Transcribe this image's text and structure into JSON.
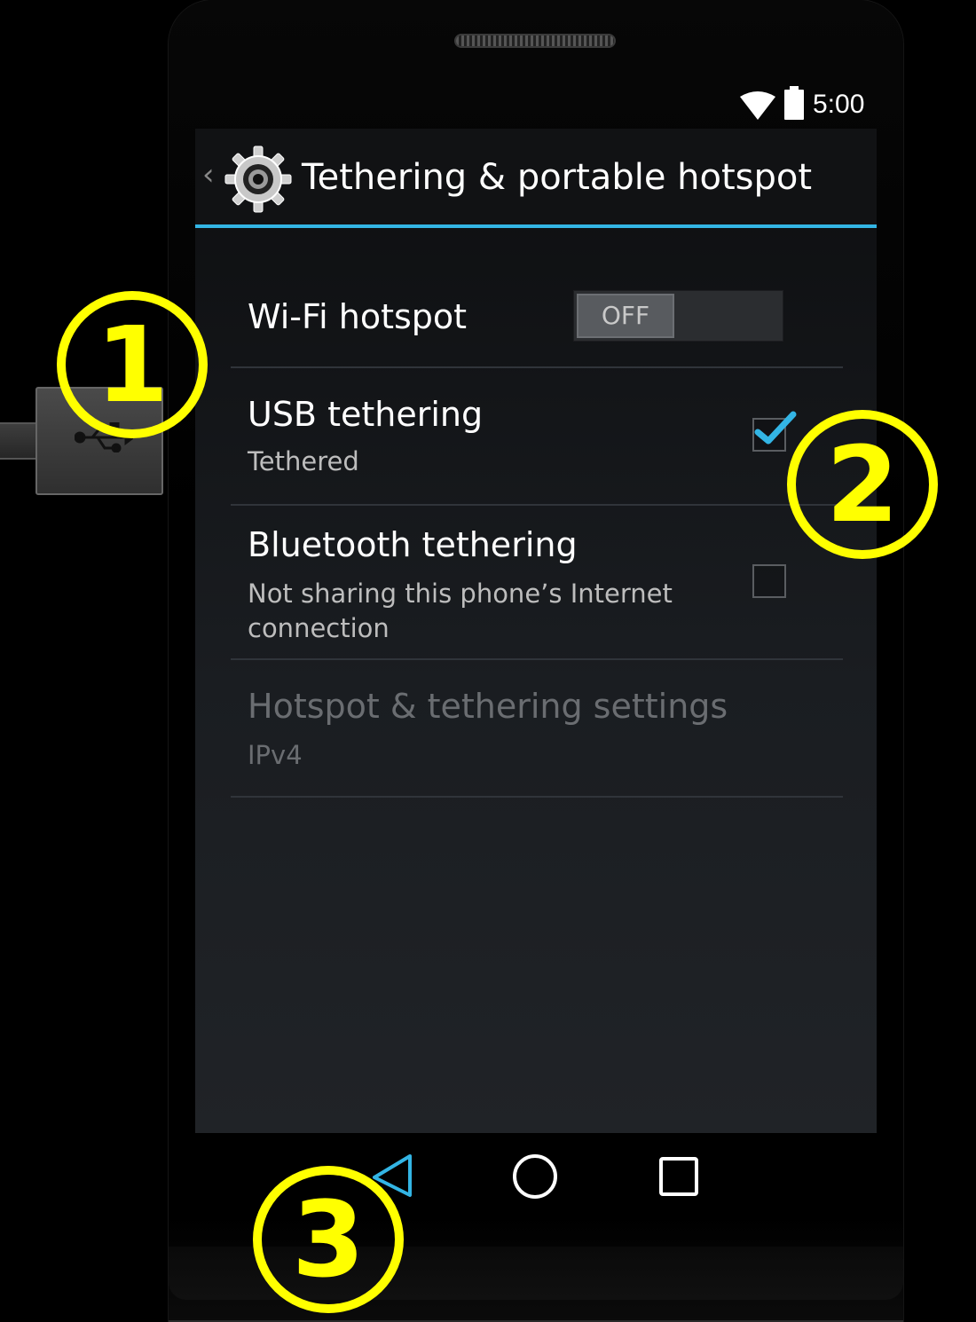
{
  "status_bar": {
    "time": "5:00",
    "icons": [
      "wifi-icon",
      "battery-icon"
    ]
  },
  "action_bar": {
    "title": "Tethering & portable hotspot",
    "icon": "settings-gear-icon"
  },
  "settings": [
    {
      "title": "Wi-Fi hotspot",
      "control": "toggle",
      "toggle_label": "OFF"
    },
    {
      "title": "USB tethering",
      "summary": "Tethered",
      "control": "checkbox",
      "checked": true
    },
    {
      "title": "Bluetooth tethering",
      "summary": "Not sharing this phone’s Internet connection",
      "control": "checkbox",
      "checked": false
    },
    {
      "title": "Hotspot & tethering settings",
      "summary": "IPv4",
      "enabled": false
    }
  ],
  "nav_bar": {
    "buttons": [
      "back-icon",
      "home-icon",
      "recents-icon"
    ],
    "accent": "#33b5e5"
  },
  "callouts": [
    "1",
    "2",
    "3"
  ],
  "colors": {
    "accent": "#33b5e5",
    "callout": "#ffff00",
    "background": "#000000"
  }
}
